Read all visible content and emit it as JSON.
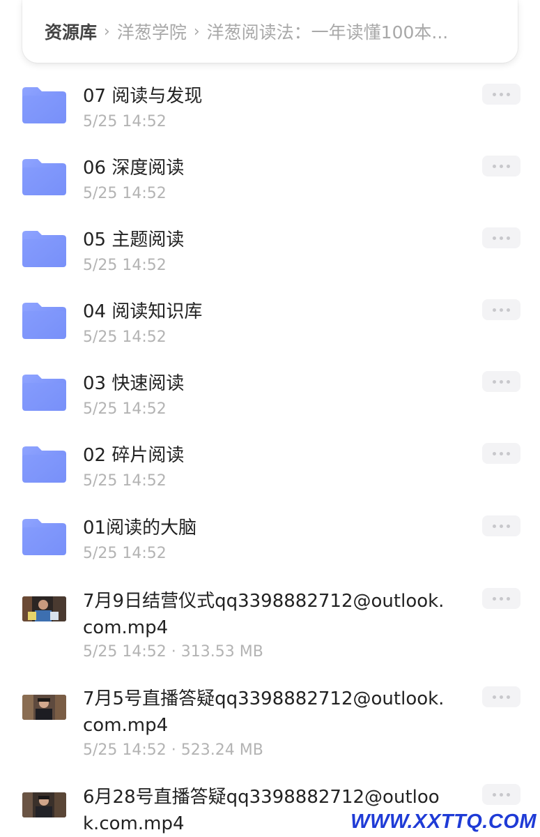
{
  "breadcrumb": {
    "root": "资源库",
    "level1": "洋葱学院",
    "level2": "洋葱阅读法：一年读懂100本..."
  },
  "files": [
    {
      "type": "folder",
      "name": "07 阅读与发现",
      "meta": "5/25 14:52"
    },
    {
      "type": "folder",
      "name": "06 深度阅读",
      "meta": "5/25 14:52"
    },
    {
      "type": "folder",
      "name": "05 主题阅读",
      "meta": "5/25 14:52"
    },
    {
      "type": "folder",
      "name": "04 阅读知识库",
      "meta": "5/25 14:52"
    },
    {
      "type": "folder",
      "name": "03 快速阅读",
      "meta": "5/25 14:52"
    },
    {
      "type": "folder",
      "name": "02 碎片阅读",
      "meta": "5/25 14:52"
    },
    {
      "type": "folder",
      "name": "01阅读的大脑",
      "meta": "5/25 14:52"
    },
    {
      "type": "video",
      "name": "7月9日结营仪式qq3398882712@outlook.com.mp4",
      "meta": "5/25 14:52 · 313.53 MB"
    },
    {
      "type": "video",
      "name": "7月5号直播答疑qq3398882712@outlook.com.mp4",
      "meta": "5/25 14:52 · 523.24 MB"
    },
    {
      "type": "video",
      "name": "6月28号直播答疑qq3398882712@outlook.com.mp4",
      "meta": ""
    }
  ],
  "icons": {
    "folder": "folder-icon",
    "more": "more-horizontal-icon",
    "chevron": "chevron-right-icon"
  },
  "colors": {
    "folder_top": "#8ea3ff",
    "folder_bottom": "#6e87f7",
    "meta_text": "#b3b3b3",
    "more_bg": "#f3f3f5"
  },
  "watermark": "WWW.XXTTQ.COM"
}
